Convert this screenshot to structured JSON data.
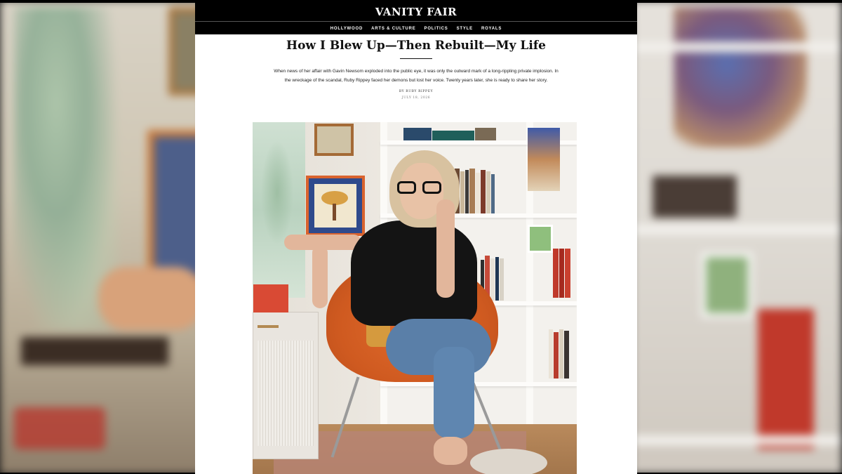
{
  "site": {
    "logo_text": "VANITY FAIR",
    "nav": [
      "HOLLYWOOD",
      "ARTS & CULTURE",
      "POLITICS",
      "STYLE",
      "ROYALS"
    ]
  },
  "article": {
    "headline": "How I Blew Up—Then Rebuilt—My Life",
    "dek": "When news of her affair with Gavin Newsom exploded into the public eye, it was only the outward mark of a long-rippling private implosion. In the wreckage of the scandal, Ruby Rippey faced her demons but lost her voice. Twenty years later, she is ready to share her story.",
    "byline": "BY RUBY RIPPEY",
    "date": "JULY 18, 2026"
  },
  "colors": {
    "masthead_bg": "#000000",
    "page_bg": "#ffffff",
    "text": "#111111"
  }
}
